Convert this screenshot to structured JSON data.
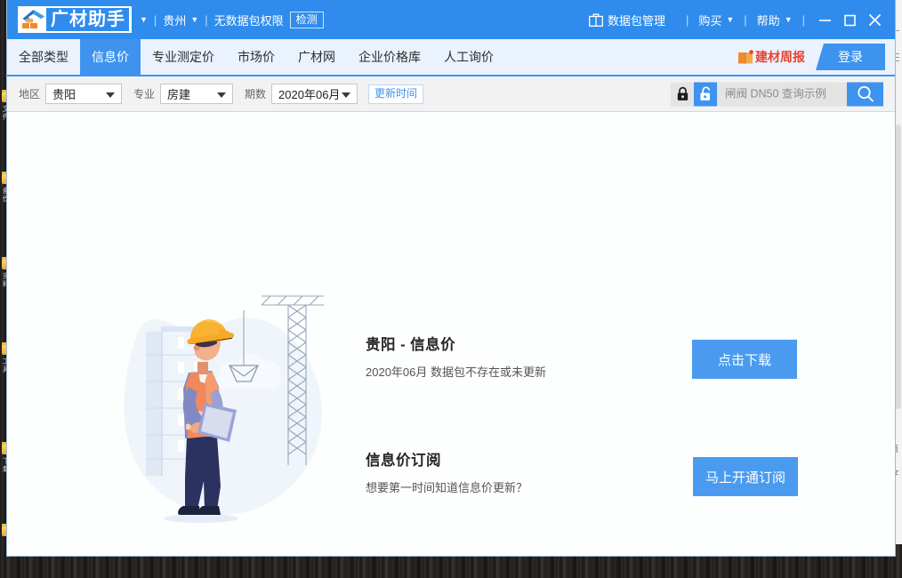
{
  "titlebar": {
    "logo_text": "广材助手",
    "region": "贵州",
    "permission": "无数据包权限",
    "detect_label": "检测",
    "package_manage": "数据包管理",
    "purchase": "购买",
    "help": "帮助",
    "separator": "|",
    "caret": "▼",
    "icons": {
      "package": "package-icon",
      "minimize": "minimize-icon",
      "maximize": "maximize-icon",
      "close": "close-icon"
    },
    "accent_color": "#2f8ced"
  },
  "nav": {
    "tabs": [
      {
        "label": "全部类型",
        "active": false
      },
      {
        "label": "信息价",
        "active": true
      },
      {
        "label": "专业测定价",
        "active": false
      },
      {
        "label": "市场价",
        "active": false
      },
      {
        "label": "广材网",
        "active": false
      },
      {
        "label": "企业价格库",
        "active": false
      },
      {
        "label": "人工询价",
        "active": false
      }
    ],
    "weekly_label": "建材周报",
    "login_label": "登录",
    "active_color": "#3d93ee",
    "weekly_color": "#e8412e"
  },
  "filters": {
    "area_label": "地区",
    "area_value": "贵阳",
    "major_label": "专业",
    "major_value": "房建",
    "period_label": "期数",
    "period_value": "2020年06月",
    "update_label": "更新时间",
    "lock_closed_icon": "lock-closed-icon",
    "lock_open_icon": "lock-open-icon",
    "search_placeholder": "闸阀 DN50 查询示例",
    "search_value": "",
    "search_icon": "search-icon"
  },
  "main": {
    "blocks": [
      {
        "title": "贵阳 - 信息价",
        "subtitle": "2020年06月 数据包不存在或未更新",
        "button": "点击下载"
      },
      {
        "title": "信息价订阅",
        "subtitle": "想要第一时间知道信息价更新？",
        "button": "马上开通订阅"
      }
    ],
    "illustration": "construction-worker-illustration",
    "button_color": "#4a9bf0"
  },
  "desktop": {
    "icon_labels": [
      "文件",
      "备份",
      "资料",
      "工具",
      "下载"
    ]
  }
}
